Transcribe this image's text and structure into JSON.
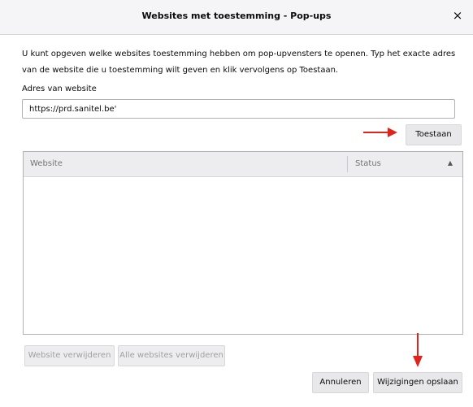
{
  "dialog": {
    "title": "Websites met toestemming - Pop-ups",
    "close_glyph": "×"
  },
  "description": "U kunt opgeven welke websites toestemming hebben om pop-upvensters te openen. Typ het exacte adres van de website die u toestemming wilt geven en klik vervolgens op Toestaan.",
  "address_field": {
    "label": "Adres van website",
    "value": "https://prd.sanitel.be'"
  },
  "buttons": {
    "allow": "Toestaan",
    "remove_website": "Website verwijderen",
    "remove_all": "Alle websites verwijderen",
    "cancel": "Annuleren",
    "save": "Wijzigingen opslaan"
  },
  "table": {
    "columns": [
      "Website",
      "Status"
    ],
    "rows": []
  },
  "icons": {
    "close": "close-icon",
    "sort": "sort-ascending-icon",
    "annotation_arrow": "red-arrow-icon"
  },
  "colors": {
    "annotation_arrow": "#e2231a"
  }
}
